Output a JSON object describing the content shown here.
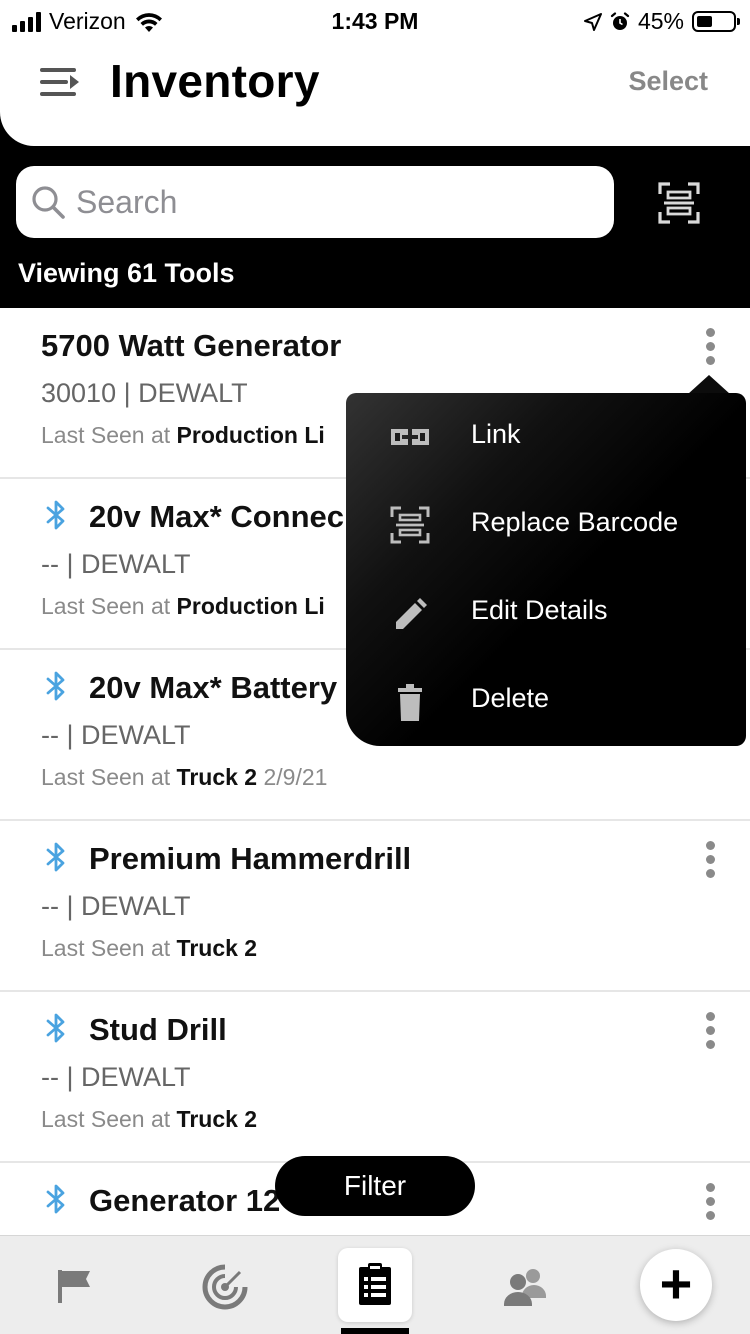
{
  "status_bar": {
    "carrier": "Verizon",
    "time": "1:43 PM",
    "battery_text": "45%",
    "battery_level": 0.45
  },
  "header": {
    "title": "Inventory",
    "select_label": "Select"
  },
  "search": {
    "placeholder": "Search"
  },
  "viewing_label": "Viewing 61 Tools",
  "last_seen_prefix": "Last Seen at",
  "tools": [
    {
      "name": "5700 Watt Generator",
      "sub": "30010 | DEWALT",
      "location": "Production Li",
      "date": "",
      "bluetooth": false
    },
    {
      "name": "20v Max* Connec",
      "sub": "-- | DEWALT",
      "location": "Production Li",
      "date": "",
      "bluetooth": true
    },
    {
      "name": "20v Max* Battery",
      "sub": "-- | DEWALT",
      "location": "Truck 2",
      "date": "2/9/21",
      "bluetooth": true
    },
    {
      "name": "Premium Hammerdrill",
      "sub": "-- | DEWALT",
      "location": "Truck 2",
      "date": "",
      "bluetooth": true
    },
    {
      "name": "Stud Drill",
      "sub": "-- | DEWALT",
      "location": "Truck 2",
      "date": "",
      "bluetooth": true
    },
    {
      "name": "Generator 12",
      "bluetooth": true
    }
  ],
  "context_menu": {
    "items": [
      {
        "label": "Link",
        "icon": "link-icon"
      },
      {
        "label": "Replace Barcode",
        "icon": "barcode-scan-icon"
      },
      {
        "label": "Edit Details",
        "icon": "pencil-icon"
      },
      {
        "label": "Delete",
        "icon": "trash-icon"
      }
    ]
  },
  "filter_label": "Filter",
  "tabbar": {
    "tabs": [
      {
        "icon": "flag-icon"
      },
      {
        "icon": "radar-icon"
      },
      {
        "icon": "clipboard-icon",
        "active": true
      },
      {
        "icon": "people-icon"
      },
      {
        "icon": "plus-icon"
      }
    ]
  },
  "colors": {
    "bluetooth": "#4aa3e0",
    "accent_dark": "#000000",
    "secondary_text": "#666666"
  }
}
